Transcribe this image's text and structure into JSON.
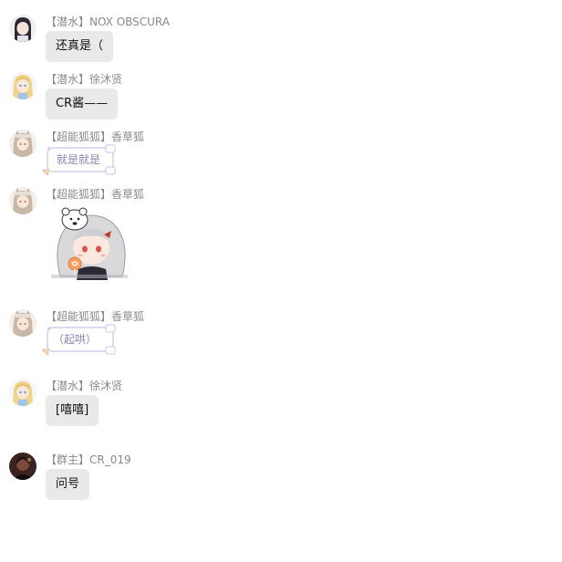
{
  "messages": [
    {
      "nick": "【潜水】NOX OBSCURA",
      "text": "还真是（",
      "avatar": "avatar-dark-hair-girl",
      "kind": "text"
    },
    {
      "nick": "【潜水】徐沐贤",
      "text": "CR酱——",
      "avatar": "avatar-blonde-girl",
      "kind": "text"
    },
    {
      "nick": "【超能狐狐】香草狐",
      "text": "就是就是",
      "avatar": "avatar-fox-girl",
      "kind": "fancy"
    },
    {
      "nick": "【超能狐狐】香草狐",
      "text": "",
      "avatar": "avatar-fox-girl",
      "kind": "sticker",
      "sticker": "chibi-girl-with-bear-hat-eating-lollipop"
    },
    {
      "nick": "【超能狐狐】香草狐",
      "text": "（起哄）",
      "avatar": "avatar-fox-girl",
      "kind": "fancy"
    },
    {
      "nick": "【潜水】徐沐贤",
      "text": "[嘻嘻]",
      "avatar": "avatar-blonde-girl",
      "kind": "text"
    },
    {
      "nick": "【群主】CR_019",
      "text": "问号",
      "avatar": "avatar-dark-portrait",
      "kind": "text"
    }
  ],
  "colors": {
    "bubble": "#e9e9e9",
    "nick": "#8a8a8a",
    "fancy_text": "#8b84b4",
    "fancy_border": "#c9c4e6"
  }
}
